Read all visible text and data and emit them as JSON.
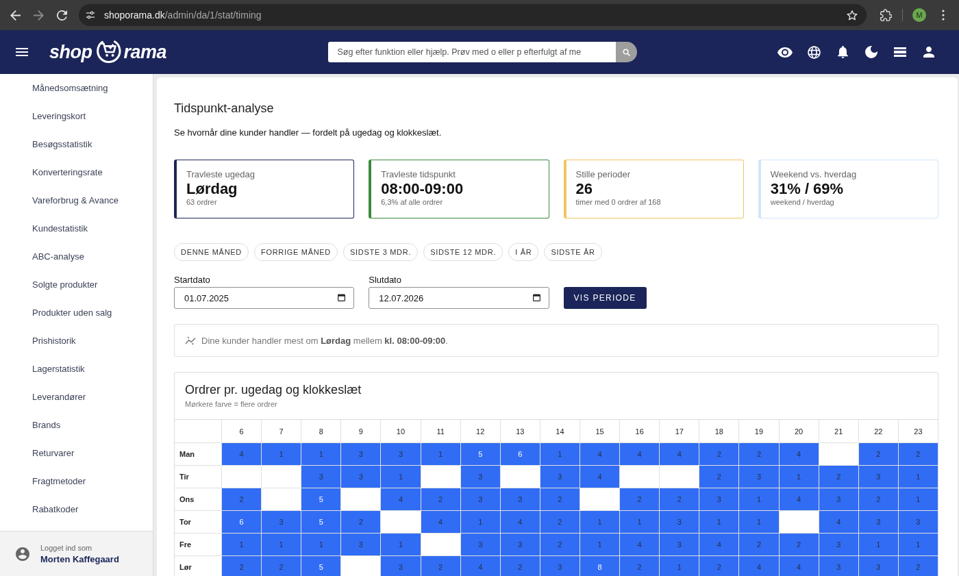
{
  "browser": {
    "back": {
      "disabled": false
    },
    "forward": {
      "disabled": true
    },
    "url": {
      "host": "shoporama.dk",
      "path": "/admin/da/1/stat/timing"
    },
    "profile": {
      "initial": "M"
    }
  },
  "header": {
    "logo": {
      "left": "shop",
      "right": "rama"
    },
    "search": {
      "placeholder": "Søg efter funktion eller hjælp. Prøv med o eller p efterfulgt af me"
    }
  },
  "sidebar": {
    "items": [
      "Månedsomsætning",
      "Leveringskort",
      "Besøgsstatistik",
      "Konverteringsrate",
      "Vareforbrug & Avance",
      "Kundestatistik",
      "ABC-analyse",
      "Solgte produkter",
      "Produkter uden salg",
      "Prishistorik",
      "Lagerstatistik",
      "Leverandører",
      "Brands",
      "Returvarer",
      "Fragtmetoder",
      "Rabatkoder"
    ],
    "footer": {
      "caption": "Logget ind som",
      "user": "Morten Kaffegaard"
    }
  },
  "page": {
    "title": "Tidspunkt-analyse",
    "description": "Se hvornår dine kunder handler — fordelt på ugedag og klokkeslæt."
  },
  "kpi_cards": [
    {
      "label": "Travleste ugedag",
      "value": "Lørdag",
      "note": "63 ordrer",
      "color": "#1b2559"
    },
    {
      "label": "Travleste tidspunkt",
      "value": "08:00-09:00",
      "note": "6,3% af alle ordrer",
      "color": "#3d8b40"
    },
    {
      "label": "Stille perioder",
      "value": "26",
      "note": "timer med 0 ordrer af 168",
      "color": "#f2c462"
    },
    {
      "label": "Weekend vs. hverdag",
      "value": "31% / 69%",
      "note": "weekend / hverdag",
      "color": "#cfe6fb"
    }
  ],
  "period_buttons": [
    "DENNE MÅNED",
    "FORRIGE MÅNED",
    "SIDSTE 3 MDR.",
    "SIDSTE 12 MDR.",
    "I ÅR",
    "SIDSTE ÅR"
  ],
  "date_fields": [
    {
      "label": "Startdato",
      "value": "01.07.2025"
    },
    {
      "label": "Slutdato",
      "value": "12.07.2026"
    }
  ],
  "submit_button": "VIS PERIODE",
  "insight": "Dine kunder handler mest om **Lørdag** mellem **kl. 08:00-09:00**.",
  "heatmap": {
    "title": "Ordrer pr. ugedag og klokkeslæt",
    "subtitle": "Mørkere farve = flere ordrer",
    "columns": [
      "6",
      "7",
      "8",
      "9",
      "10",
      "11",
      "12",
      "13",
      "14",
      "15",
      "16",
      "17",
      "18",
      "19",
      "20",
      "21",
      "22",
      "23"
    ],
    "rows": [
      {
        "label": "Man",
        "cells": [
          "4",
          "1",
          "1",
          "3",
          "3",
          "1",
          "5",
          "6",
          "1",
          "4",
          "4",
          "4",
          "2",
          "2",
          "4",
          null,
          "2",
          "2"
        ]
      },
      {
        "label": "Tir",
        "cells": [
          null,
          null,
          "3",
          "3",
          "1",
          null,
          "3",
          null,
          "3",
          "4",
          null,
          null,
          "2",
          "3",
          "1",
          "2",
          "3",
          "1"
        ]
      },
      {
        "label": "Ons",
        "cells": [
          "2",
          null,
          "5",
          null,
          "4",
          "2",
          "3",
          "3",
          "2",
          null,
          "2",
          "2",
          "3",
          "1",
          "4",
          "3",
          "2",
          "1"
        ]
      },
      {
        "label": "Tor",
        "cells": [
          "6",
          "3",
          "5",
          "2",
          null,
          "4",
          "1",
          "4",
          "2",
          "1",
          "1",
          "3",
          "1",
          "1",
          null,
          "4",
          "3",
          "3"
        ]
      },
      {
        "label": "Fre",
        "cells": [
          "1",
          "1",
          "1",
          "3",
          "1",
          null,
          "3",
          "3",
          "2",
          "1",
          "4",
          "3",
          "4",
          "2",
          "2",
          "3",
          "1",
          "1"
        ]
      },
      {
        "label": "Lør",
        "cells": [
          "2",
          "2",
          "5",
          null,
          "3",
          "2",
          "4",
          "2",
          "3",
          "8",
          "2",
          "1",
          "2",
          "4",
          "4",
          "3",
          "3",
          "2"
        ]
      }
    ]
  }
}
